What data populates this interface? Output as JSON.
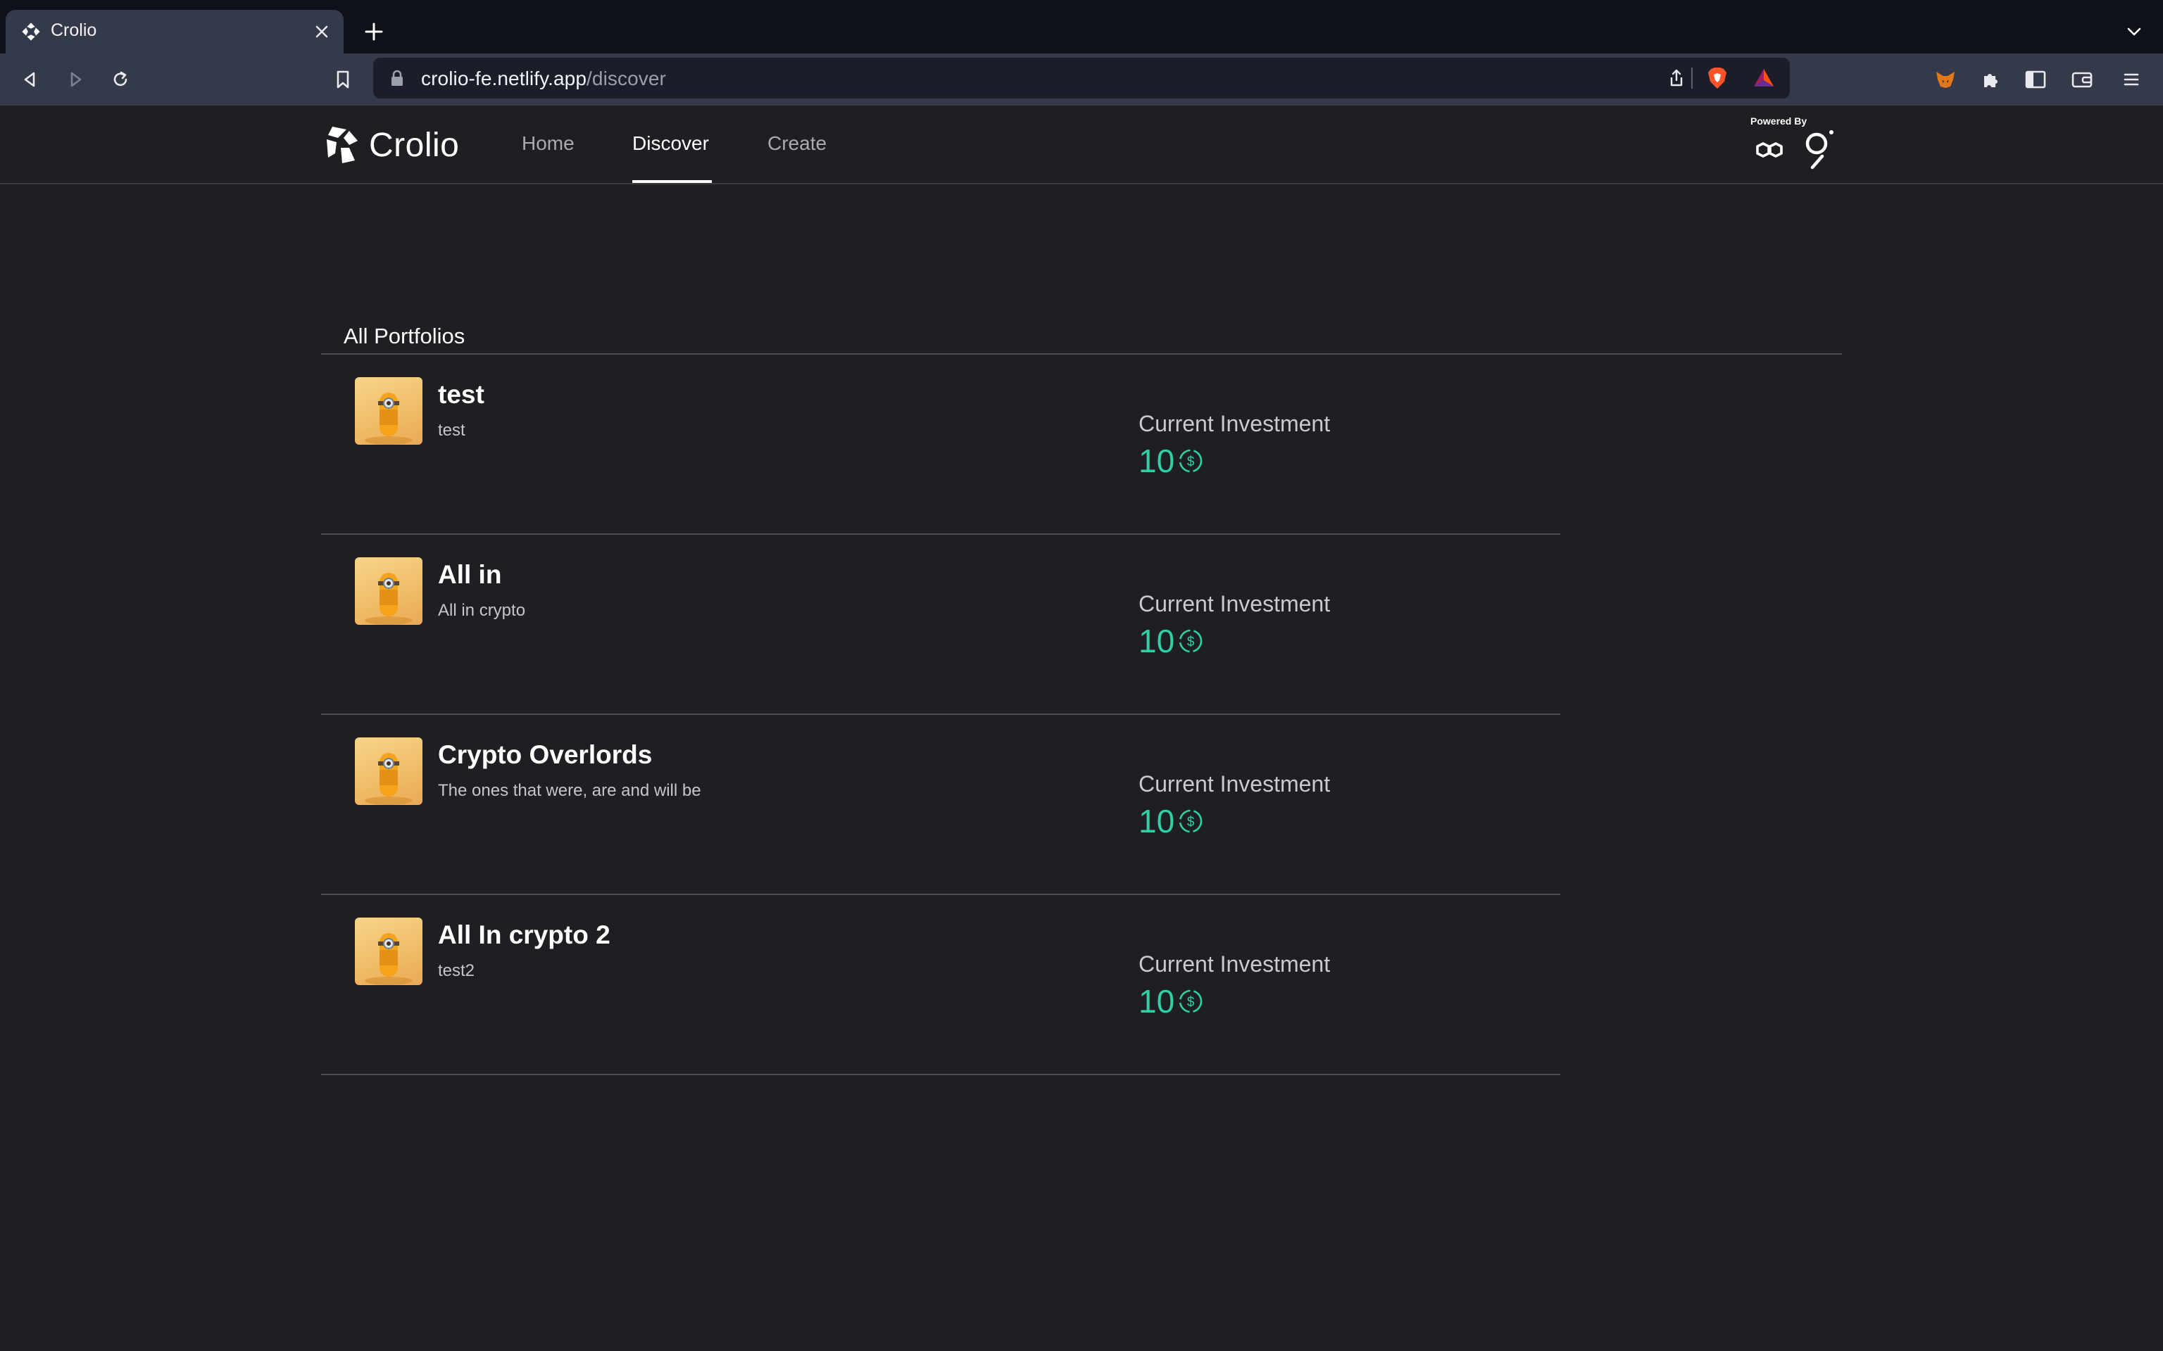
{
  "browser": {
    "tab_title": "Crolio",
    "url_host": "crolio-fe.netlify.app",
    "url_path": "/discover"
  },
  "site": {
    "logo_text": "Crolio",
    "nav": [
      {
        "label": "Home",
        "active": false
      },
      {
        "label": "Discover",
        "active": true
      },
      {
        "label": "Create",
        "active": false
      }
    ],
    "powered_by": "Powered By"
  },
  "main": {
    "section_title": "All Portfolios",
    "investment_label": "Current Investment",
    "portfolios": [
      {
        "title": "test",
        "description": "test",
        "investment": "10"
      },
      {
        "title": "All in",
        "description": "All in crypto",
        "investment": "10"
      },
      {
        "title": "Crypto Overlords",
        "description": "The ones that were, are and will be",
        "investment": "10"
      },
      {
        "title": "All In crypto 2",
        "description": "test2",
        "investment": "10"
      }
    ]
  },
  "colors": {
    "accent": "#2fd0a6",
    "background": "#1e1f22",
    "chrome": "#343a49"
  }
}
